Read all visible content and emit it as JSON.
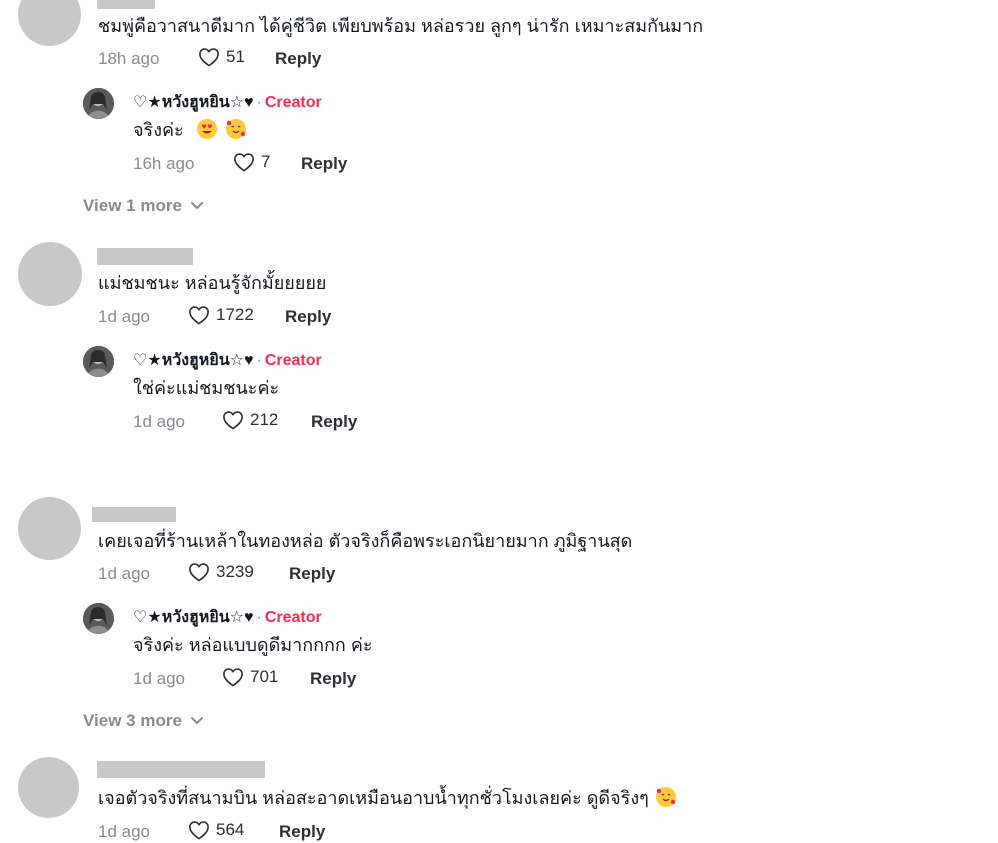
{
  "comments": [
    {
      "text": "ชมพู่คือวาสนาดีมาก ได้คู่ชีวิต เพียบพร้อม หล่อรวย ลูกๆ น่ารัก เหมาะสมกันมาก",
      "time": "18h ago",
      "likes": "51",
      "reply": "Reply",
      "creator_reply": {
        "username": "♡★หวังฮูหยิน☆♥",
        "badge": "Creator",
        "text": "จริงค่ะ",
        "emojis": [
          "heart-eyes-emoji",
          "smiling-face-with-hearts-emoji"
        ],
        "time": "16h ago",
        "likes": "7",
        "reply": "Reply"
      },
      "view_more": "View 1 more"
    },
    {
      "text": "แม่ชมชนะ หล่อนรู้จักมั้ยยยยย",
      "time": "1d ago",
      "likes": "1722",
      "reply": "Reply",
      "creator_reply": {
        "username": "♡★หวังฮูหยิน☆♥",
        "badge": "Creator",
        "text": "ใช่ค่ะแม่ชมชนะค่ะ",
        "time": "1d ago",
        "likes": "212",
        "reply": "Reply"
      }
    },
    {
      "text": "เคยเจอที่ร้านเหล้าในทองหล่อ ตัวจริงก็คือพระเอกนิยายมาก ภูมิฐานสุด",
      "time": "1d ago",
      "likes": "3239",
      "reply": "Reply",
      "creator_reply": {
        "username": "♡★หวังฮูหยิน☆♥",
        "badge": "Creator",
        "text": "จริงค่ะ หล่อแบบดูดีมากกกก ค่ะ",
        "time": "1d ago",
        "likes": "701",
        "reply": "Reply"
      },
      "view_more": "View 3 more"
    },
    {
      "text": "เจอตัวจริงที่สนามบิน หล่อสะอาดเหมือนอาบน้ำทุกชั่วโมงเลยค่ะ ดูดีจริงๆ",
      "emoji": "smiling-face-with-hearts-emoji",
      "time": "1d ago",
      "likes": "564",
      "reply": "Reply"
    }
  ],
  "separator": "·",
  "colors": {
    "creator": "#fe2c55",
    "muted": "#8a8b91",
    "placeholder": "#c8c8c8"
  }
}
